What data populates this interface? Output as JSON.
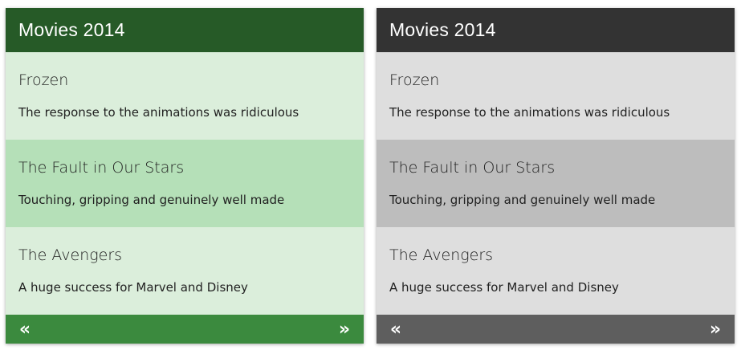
{
  "colors": {
    "green_header": "#265a27",
    "green_item": "#dbeedb",
    "green_item_active": "#b5e0b8",
    "green_footer": "#3b8a3e",
    "gray_header": "#333333",
    "gray_item": "#dedede",
    "gray_item_active": "#bdbdbd",
    "gray_footer": "#5e5e5e",
    "text_dark": "#212121"
  },
  "icons": {
    "prev": "double-chevron-left-icon",
    "next": "double-chevron-right-icon"
  },
  "cards": [
    {
      "theme": "green",
      "title": "Movies 2014",
      "active_index": 1,
      "items": [
        {
          "title": "Frozen",
          "desc": "The response to the animations was ridiculous"
        },
        {
          "title": "The Fault in Our Stars",
          "desc": "Touching, gripping and genuinely well made"
        },
        {
          "title": "The Avengers",
          "desc": "A huge success for Marvel and Disney"
        }
      ],
      "prev_glyph": "«",
      "next_glyph": "»"
    },
    {
      "theme": "gray",
      "title": "Movies 2014",
      "active_index": 1,
      "items": [
        {
          "title": "Frozen",
          "desc": "The response to the animations was ridiculous"
        },
        {
          "title": "The Fault in Our Stars",
          "desc": "Touching, gripping and genuinely well made"
        },
        {
          "title": "The Avengers",
          "desc": "A huge success for Marvel and Disney"
        }
      ],
      "prev_glyph": "«",
      "next_glyph": "»"
    }
  ]
}
